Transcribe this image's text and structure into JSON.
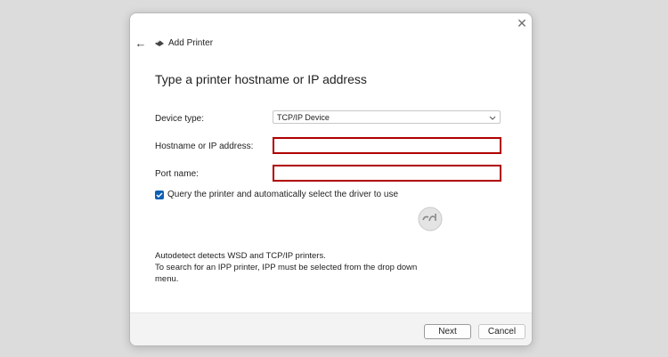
{
  "dialog": {
    "title": "Add Printer",
    "close_glyph": "✕",
    "back_glyph": "←",
    "heading": "Type a printer hostname or IP address"
  },
  "form": {
    "device_type_label": "Device type:",
    "device_type_value": "TCP/IP Device",
    "hostname_label": "Hostname or IP address:",
    "hostname_value": "",
    "port_label": "Port name:",
    "port_value": "",
    "query_checked": true,
    "query_label": "Query the printer and automatically select the driver to use"
  },
  "info": {
    "line1": "Autodetect detects WSD and TCP/IP printers.",
    "line2": "To search for an IPP printer, IPP must be selected from the drop down",
    "line3": "menu."
  },
  "buttons": {
    "next_label": "Next",
    "cancel_label": "Cancel"
  },
  "colors": {
    "accent": "#0f5fb4",
    "error_border": "#b00000"
  },
  "icons": {
    "title": "printer-icon",
    "back": "back-arrow-icon",
    "close": "close-icon",
    "dropdown": "chevron-down-icon",
    "watermark": "watermark-logo"
  }
}
